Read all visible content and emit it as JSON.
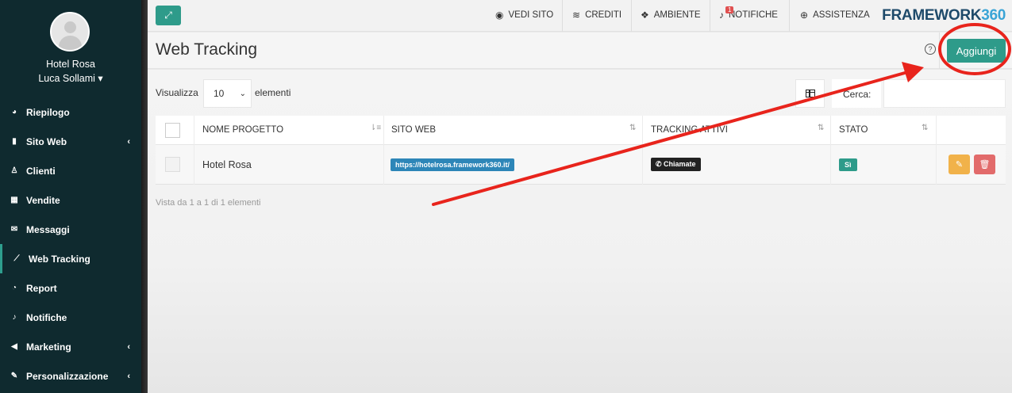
{
  "sidebar": {
    "hotel_name": "Hotel Rosa",
    "user_name": "Luca Sollami ▾",
    "items": [
      {
        "label": "Riepilogo",
        "icon": "dashboard-icon",
        "glyph": "◕"
      },
      {
        "label": "Sito Web",
        "icon": "file-icon",
        "glyph": "▮",
        "chevron": "‹"
      },
      {
        "label": "Clienti",
        "icon": "person-icon",
        "glyph": "♙"
      },
      {
        "label": "Vendite",
        "icon": "calculator-icon",
        "glyph": "▦"
      },
      {
        "label": "Messaggi",
        "icon": "envelope-icon",
        "glyph": "✉"
      },
      {
        "label": "Web Tracking",
        "icon": "chart-line-icon",
        "glyph": "⟋",
        "active": true
      },
      {
        "label": "Report",
        "icon": "pie-chart-icon",
        "glyph": "◔"
      },
      {
        "label": "Notifiche",
        "icon": "bell-icon",
        "glyph": "♪"
      },
      {
        "label": "Marketing",
        "icon": "megaphone-icon",
        "glyph": "◀",
        "chevron": "‹"
      },
      {
        "label": "Personalizzazione",
        "icon": "brush-icon",
        "glyph": "✎",
        "chevron": "‹"
      }
    ]
  },
  "topbar": {
    "expand_glyph": "⤢",
    "vedi_sito": "VEDI SITO",
    "crediti": "CREDITI",
    "ambiente": "AMBIENTE",
    "notifiche": "NOTIFICHE",
    "notifiche_count": "1",
    "assistenza": "ASSISTENZA",
    "brand_text": "FRAMEWORK",
    "brand_num": "360"
  },
  "page": {
    "title": "Web Tracking",
    "add_button": "Aggiungi"
  },
  "table_controls": {
    "show_label": "Visualizza",
    "show_value": "10",
    "show_suffix": "elementi",
    "search_label": "Cerca:"
  },
  "table": {
    "columns": [
      "NOME PROGETTO",
      "SITO WEB",
      "TRACKING ATTIVI",
      "STATO"
    ],
    "rows": [
      {
        "name": "Hotel Rosa",
        "site": "https://hotelrosa.framework360.it/",
        "tracking": "Chiamate",
        "status": "Sì"
      }
    ],
    "info": "Vista da 1 a 1 di 1 elementi"
  },
  "colors": {
    "accent": "#2e9b8a",
    "sidebar_bg": "#0f2a2f",
    "annotation_red": "#e8241c"
  }
}
